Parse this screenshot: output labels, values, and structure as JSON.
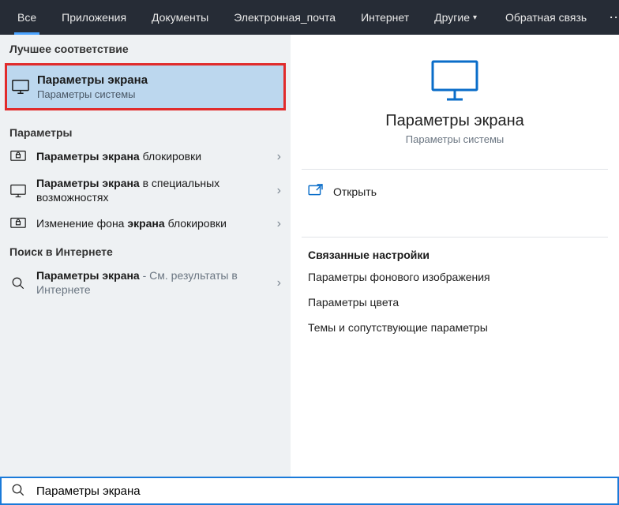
{
  "tabs": {
    "all": "Все",
    "apps": "Приложения",
    "docs": "Документы",
    "email": "Электронная_почта",
    "internet": "Интернет",
    "other": "Другие",
    "feedback": "Обратная связь"
  },
  "sections": {
    "best_match": "Лучшее соответствие",
    "settings": "Параметры",
    "web": "Поиск в Интернете"
  },
  "best_match": {
    "title": "Параметры экрана",
    "subtitle": "Параметры системы"
  },
  "settings_list": [
    {
      "bold": "Параметры экрана",
      "rest": " блокировки"
    },
    {
      "bold": "Параметры экрана",
      "rest": " в специальных возможностях"
    },
    {
      "pre": "Изменение фона ",
      "bold": "экрана",
      "rest": " блокировки"
    }
  ],
  "web_list": [
    {
      "bold": "Параметры экрана",
      "mut": " - См. результаты в Интернете"
    }
  ],
  "details": {
    "title": "Параметры экрана",
    "subtitle": "Параметры системы",
    "open": "Открыть",
    "related_heading": "Связанные настройки",
    "related": [
      "Параметры фонового изображения",
      "Параметры цвета",
      "Темы и сопутствующие параметры"
    ]
  },
  "search": {
    "value": "Параметры экрана"
  },
  "colors": {
    "highlight_border": "#e12b2b",
    "accent": "#1a7ad9"
  }
}
